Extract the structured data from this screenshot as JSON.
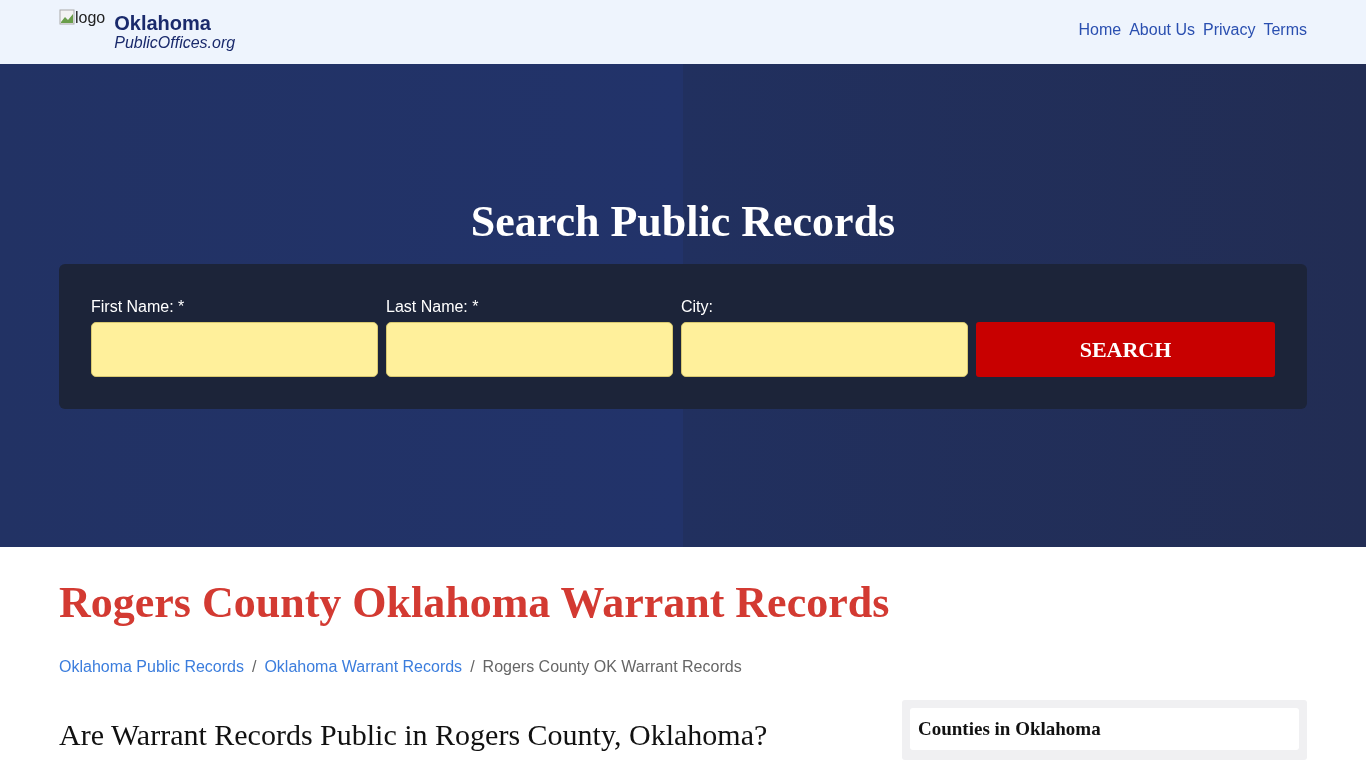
{
  "header": {
    "logo_alt": "logo",
    "brand_name": "Oklahoma",
    "brand_sub": "PublicOffices.org",
    "nav": [
      "Home",
      "About Us",
      "Privacy",
      "Terms"
    ]
  },
  "hero": {
    "title": "Search Public Records",
    "fields": [
      {
        "label": "First Name: *"
      },
      {
        "label": "Last Name: *"
      },
      {
        "label": "City:"
      }
    ],
    "button": "SEARCH"
  },
  "page_title": "Rogers County Oklahoma Warrant Records",
  "breadcrumb_separator": "/",
  "breadcrumb": [
    {
      "label": "Oklahoma Public Records",
      "kind": "link"
    },
    {
      "label": "Oklahoma Warrant Records",
      "kind": "link"
    },
    {
      "label": "Rogers County OK Warrant Records",
      "kind": "current"
    }
  ],
  "article": {
    "heading": "Are Warrant Records Public in Rogers County, Oklahoma?"
  },
  "sidebar": {
    "heading": "Counties in Oklahoma"
  }
}
